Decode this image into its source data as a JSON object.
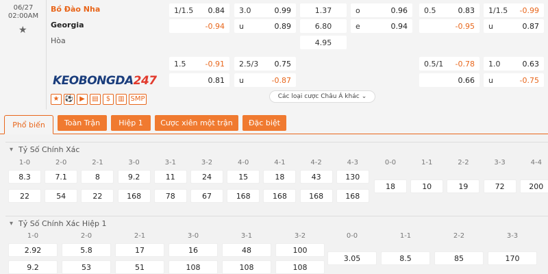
{
  "match": {
    "date": "06/27",
    "time": "02:00AM",
    "home": "Bồ Đào Nha",
    "away": "Georgia",
    "draw": "Hòa"
  },
  "logo": {
    "part1": "KEOBONGDA",
    "part2": "247"
  },
  "tools": [
    "★",
    "⚽",
    "▶",
    "▤",
    "$",
    "📊",
    "SMP"
  ],
  "odds_row1": {
    "ah_home": {
      "line": "1/1.5",
      "val": "0.84"
    },
    "ah_away": {
      "line": "",
      "val": "-0.94"
    },
    "ou_over": {
      "line": "3.0",
      "val": "0.99"
    },
    "ou_under": {
      "line": "u",
      "val": "0.89"
    },
    "x12_1": "1.37",
    "x12_2": "6.80",
    "x12_x": "4.95",
    "oe_o": {
      "line": "o",
      "val": "0.96"
    },
    "oe_e": {
      "line": "e",
      "val": "0.94"
    },
    "h1_ah_home": {
      "line": "0.5",
      "val": "0.83"
    },
    "h1_ah_away": {
      "line": "",
      "val": "-0.95"
    },
    "h1_ou_over": {
      "line": "1/1.5",
      "val": "-0.99"
    },
    "h1_ou_under": {
      "line": "u",
      "val": "0.87"
    }
  },
  "odds_row2": {
    "ah_home": {
      "line": "1.5",
      "val": "-0.91"
    },
    "ah_away": {
      "line": "",
      "val": "0.81"
    },
    "ou_over": {
      "line": "2.5/3",
      "val": "0.75"
    },
    "ou_under": {
      "line": "u",
      "val": "-0.87"
    },
    "h1_ah_home": {
      "line": "0.5/1",
      "val": "-0.78"
    },
    "h1_ah_away": {
      "line": "",
      "val": "0.66"
    },
    "h1_ou_over": {
      "line": "1.0",
      "val": "0.63"
    },
    "h1_ou_under": {
      "line": "u",
      "val": "-0.75"
    }
  },
  "more_odds_label": "Các loại cược Châu Á khác",
  "tabs": [
    "Phổ biến",
    "Toàn Trận",
    "Hiệp 1",
    "Cược xiên một trận",
    "Đặc biệt"
  ],
  "section1": {
    "title": "Tỷ Số Chính Xác",
    "home_labels": [
      "1-0",
      "2-0",
      "2-1",
      "3-0",
      "3-1",
      "3-2",
      "4-0",
      "4-1",
      "4-2",
      "4-3"
    ],
    "home_odds": [
      "8.3",
      "7.1",
      "8",
      "9.2",
      "11",
      "24",
      "15",
      "18",
      "43",
      "130"
    ],
    "away_odds": [
      "22",
      "54",
      "22",
      "168",
      "78",
      "67",
      "168",
      "168",
      "168",
      "168"
    ],
    "draw_labels": [
      "0-0",
      "1-1",
      "2-2",
      "3-3",
      "4-4"
    ],
    "draw_odds": [
      "18",
      "10",
      "19",
      "72",
      "200"
    ]
  },
  "section2": {
    "title": "Tỷ Số Chính Xác Hiệp 1",
    "home_labels": [
      "1-0",
      "2-0",
      "2-1",
      "3-0",
      "3-1",
      "3-2"
    ],
    "home_odds": [
      "2.92",
      "5.8",
      "17",
      "16",
      "48",
      "100"
    ],
    "away_odds": [
      "9.2",
      "53",
      "51",
      "108",
      "108",
      "108"
    ],
    "draw_labels": [
      "0-0",
      "1-1",
      "2-2",
      "3-3"
    ],
    "draw_odds": [
      "3.05",
      "8.5",
      "85",
      "170"
    ]
  },
  "colors": {
    "accent": "#e8661b",
    "tab_bg": "#f07a30"
  }
}
